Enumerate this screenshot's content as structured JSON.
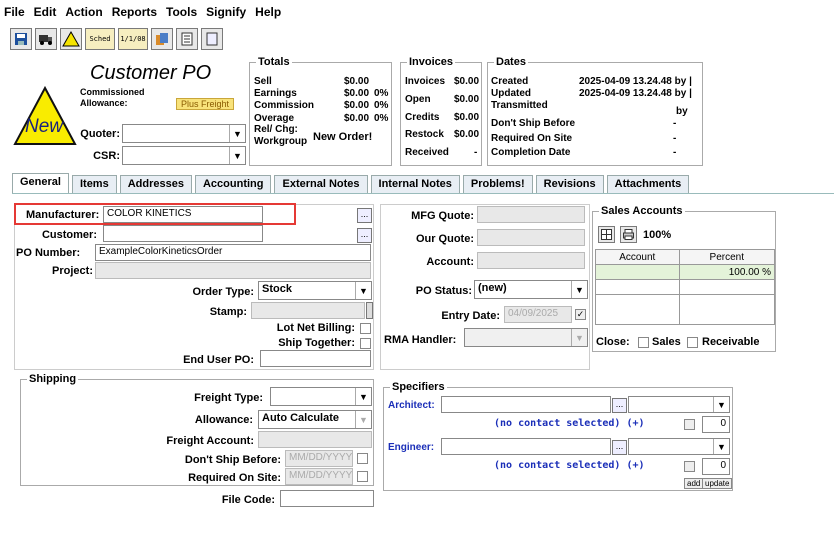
{
  "menu": [
    "File",
    "Edit",
    "Action",
    "Reports",
    "Tools",
    "Signify",
    "Help"
  ],
  "toolbar": {
    "items": [
      {
        "icon": "save-icon"
      },
      {
        "icon": "truck-icon"
      },
      {
        "icon": "new-warning-icon"
      },
      {
        "label": "Sched"
      },
      {
        "label": "1/1/08"
      },
      {
        "icon": "documents-icon"
      },
      {
        "icon": "list-icon"
      },
      {
        "icon": "page-icon"
      }
    ]
  },
  "header": {
    "title": "Customer PO",
    "status_badge": "New",
    "commissioned_label": "Commissioned",
    "allowance_label": "Allowance:",
    "plus_freight": "Plus Freight",
    "quoter_label": "Quoter:",
    "csr_label": "CSR:",
    "quoter_value": "",
    "csr_value": ""
  },
  "totals": {
    "legend": "Totals",
    "rows": [
      {
        "label": "Sell",
        "value": "$0.00",
        "pct": ""
      },
      {
        "label": "Earnings",
        "value": "$0.00",
        "pct": "0%"
      },
      {
        "label": "Commission",
        "value": "$0.00",
        "pct": "0%"
      },
      {
        "label": "Overage",
        "value": "$0.00",
        "pct": "0%"
      }
    ],
    "relchg_label": "Rel/ Chg:",
    "workgroup_label": "Workgroup",
    "new_order": "New Order!"
  },
  "invoices": {
    "legend": "Invoices",
    "rows": [
      {
        "label": "Invoices",
        "value": "$0.00"
      },
      {
        "label": "Open",
        "value": "$0.00"
      },
      {
        "label": "Credits",
        "value": "$0.00"
      },
      {
        "label": "Restock",
        "value": "$0.00"
      },
      {
        "label": "Received",
        "value": "-"
      }
    ]
  },
  "dates": {
    "legend": "Dates",
    "rows": [
      {
        "label": "Created",
        "value": "2025-04-09 13.24.48 by |"
      },
      {
        "label": "Updated",
        "value": "2025-04-09 13.24.48 by |"
      },
      {
        "label": "Transmitted",
        "value": "by"
      },
      {
        "label": "Don't Ship Before",
        "value": "-"
      },
      {
        "label": "Required On Site",
        "value": "-"
      },
      {
        "label": "Completion Date",
        "value": "-"
      }
    ]
  },
  "tabs": [
    "General",
    "Items",
    "Addresses",
    "Accounting",
    "External Notes",
    "Internal Notes",
    "Problems!",
    "Revisions",
    "Attachments"
  ],
  "general": {
    "manufacturer_label": "Manufacturer:",
    "manufacturer_value": "COLOR KINETICS",
    "customer_label": "Customer:",
    "customer_value": "",
    "po_number_label": "PO Number:",
    "po_number_value": "ExampleColorKineticsOrder",
    "project_label": "Project:",
    "order_type_label": "Order Type:",
    "order_type_value": "Stock",
    "stamp_label": "Stamp:",
    "lot_net_label": "Lot Net Billing:",
    "ship_together_label": "Ship Together:",
    "end_user_label": "End User PO:",
    "mfg_quote_label": "MFG Quote:",
    "our_quote_label": "Our Quote:",
    "account_label": "Account:",
    "po_status_label": "PO Status:",
    "po_status_value": "(new)",
    "entry_date_label": "Entry Date:",
    "entry_date_value": "04/09/2025",
    "rma_label": "RMA Handler:"
  },
  "sales_accounts": {
    "legend": "Sales Accounts",
    "pct": "100%",
    "col_account": "Account",
    "col_percent": "Percent",
    "row_percent": "100.00 %",
    "close_label": "Close:",
    "sales_label": "Sales",
    "receivable_label": "Receivable"
  },
  "shipping": {
    "legend": "Shipping",
    "freight_type_label": "Freight Type:",
    "allowance_label": "Allowance:",
    "allowance_value": "Auto Calculate",
    "freight_account_label": "Freight Account:",
    "dont_ship_label": "Don't Ship Before:",
    "dont_ship_placeholder": "MM/DD/YYYY",
    "required_label": "Required On Site:",
    "required_placeholder": "MM/DD/YYYY",
    "file_code_label": "File Code:"
  },
  "specifiers": {
    "legend": "Specifiers",
    "architect_label": "Architect:",
    "engineer_label": "Engineer:",
    "no_contact": "(no contact selected) (+)",
    "arch_count": "0",
    "eng_count": "0",
    "add_label": "add",
    "update_label": "update"
  }
}
